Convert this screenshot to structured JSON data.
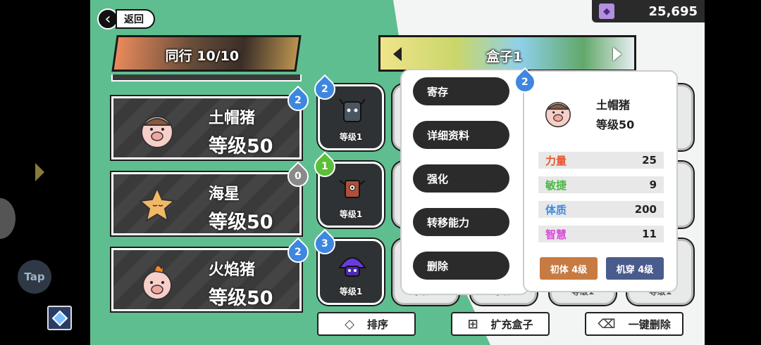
{
  "nav": {
    "back_label": "返回"
  },
  "currency": {
    "icon": "gem-icon",
    "value": "25,695"
  },
  "party": {
    "title": "同行 10/10"
  },
  "box": {
    "title": "盒子1"
  },
  "members": [
    {
      "name": "土帽猪",
      "level": "等级50",
      "badge": "2",
      "badge_color": "#3d87e0"
    },
    {
      "name": "海星",
      "level": "等级50",
      "badge": "0",
      "badge_color": "#8a8a8a"
    },
    {
      "name": "火焰猪",
      "level": "等级50",
      "badge": "2",
      "badge_color": "#3d87e0"
    }
  ],
  "box_slots": [
    {
      "level": "等级1",
      "badge": "2",
      "monster": "stump-monster"
    },
    {
      "level": "等级1",
      "badge": "1",
      "monster": "crab-monster"
    },
    {
      "level": "等级1",
      "badge": "3",
      "monster": "mushroom-monster"
    }
  ],
  "hidden_slot_partial_labels": [
    "等级50",
    "等级1",
    "等级1",
    "等级1"
  ],
  "context_menu": [
    {
      "label": "寄存"
    },
    {
      "label": "详细资料"
    },
    {
      "label": "强化"
    },
    {
      "label": "转移能力"
    },
    {
      "label": "删除"
    }
  ],
  "detail": {
    "badge": "2",
    "name": "土帽猪",
    "level": "等级50",
    "stats": [
      {
        "label": "力量",
        "value": "25",
        "color": "#e8552f"
      },
      {
        "label": "敏捷",
        "value": "9",
        "color": "#4cb84a"
      },
      {
        "label": "体质",
        "value": "200",
        "color": "#3d8be0"
      },
      {
        "label": "智慧",
        "value": "11",
        "color": "#d64ad6"
      }
    ],
    "tags": [
      {
        "label": "初体 4级",
        "color": "#c77a42"
      },
      {
        "label": "机穿 4级",
        "color": "#4a5c8c"
      }
    ]
  },
  "bottom_buttons": {
    "sort": "排序",
    "expand": "扩充盒子",
    "delete_all": "一键删除"
  },
  "sidebar": {
    "tap_label": "Tap"
  }
}
